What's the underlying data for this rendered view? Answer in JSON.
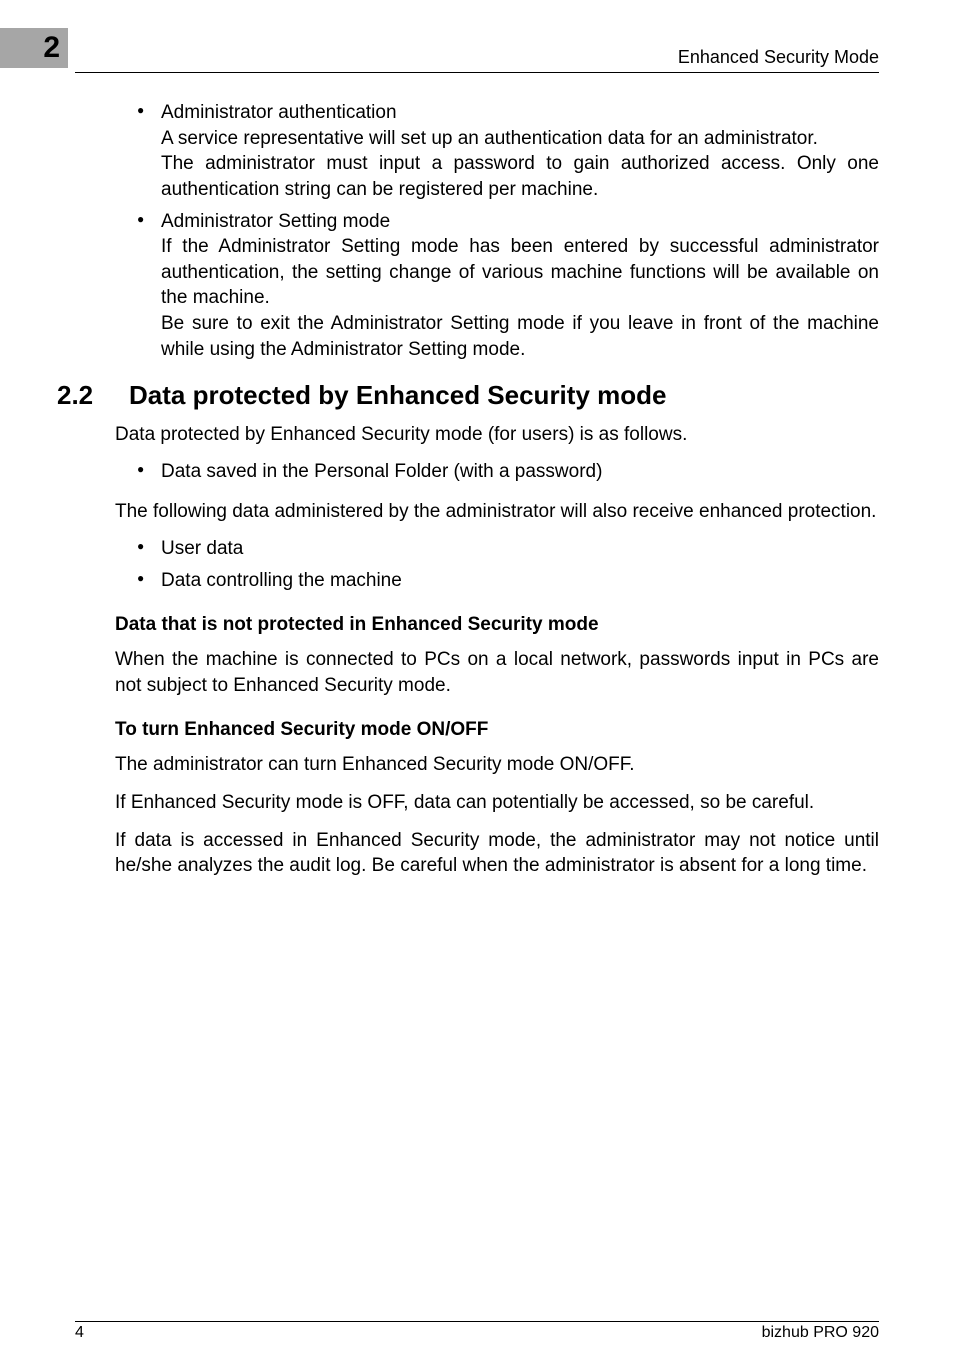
{
  "header": {
    "chapter_number": "2",
    "section_title": "Enhanced Security Mode"
  },
  "top_bullets": [
    {
      "lead": "Administrator authentication",
      "lines": [
        "A service representative will set up an authentication data for an administrator.",
        "The administrator must input a password to gain authorized access. Only one authentication string can be registered per machine."
      ]
    },
    {
      "lead": "Administrator Setting mode",
      "lines": [
        "If the Administrator Setting mode has been entered by successful administrator authentication, the setting change of various machine functions will be available on the machine.",
        "Be sure to exit the Administrator Setting mode if you leave in front of the machine while using the Administrator Setting mode."
      ]
    }
  ],
  "h2": {
    "number": "2.2",
    "title": "Data protected by Enhanced Security mode"
  },
  "p_intro": "Data protected by Enhanced Security mode (for users) is as follows.",
  "bullets_users": [
    "Data saved in the Personal Folder (with a password)"
  ],
  "p_admin_intro": "The following data administered by the administrator will also receive enhanced protection.",
  "bullets_admin": [
    "User data",
    "Data controlling the machine"
  ],
  "h3a": "Data that is not protected in Enhanced Security mode",
  "p_h3a": "When the machine is connected to PCs on a local network, passwords input in PCs are not subject to Enhanced Security mode.",
  "h3b": "To turn Enhanced Security mode ON/OFF",
  "p_h3b_1": "The administrator can turn Enhanced Security mode ON/OFF.",
  "p_h3b_2": "If Enhanced Security mode is OFF, data can potentially be accessed, so be careful.",
  "p_h3b_3": "If data is accessed in Enhanced Security mode, the administrator may not notice until he/she analyzes the audit log. Be careful when the administrator is absent for a long time.",
  "footer": {
    "page": "4",
    "product": "bizhub PRO 920"
  }
}
